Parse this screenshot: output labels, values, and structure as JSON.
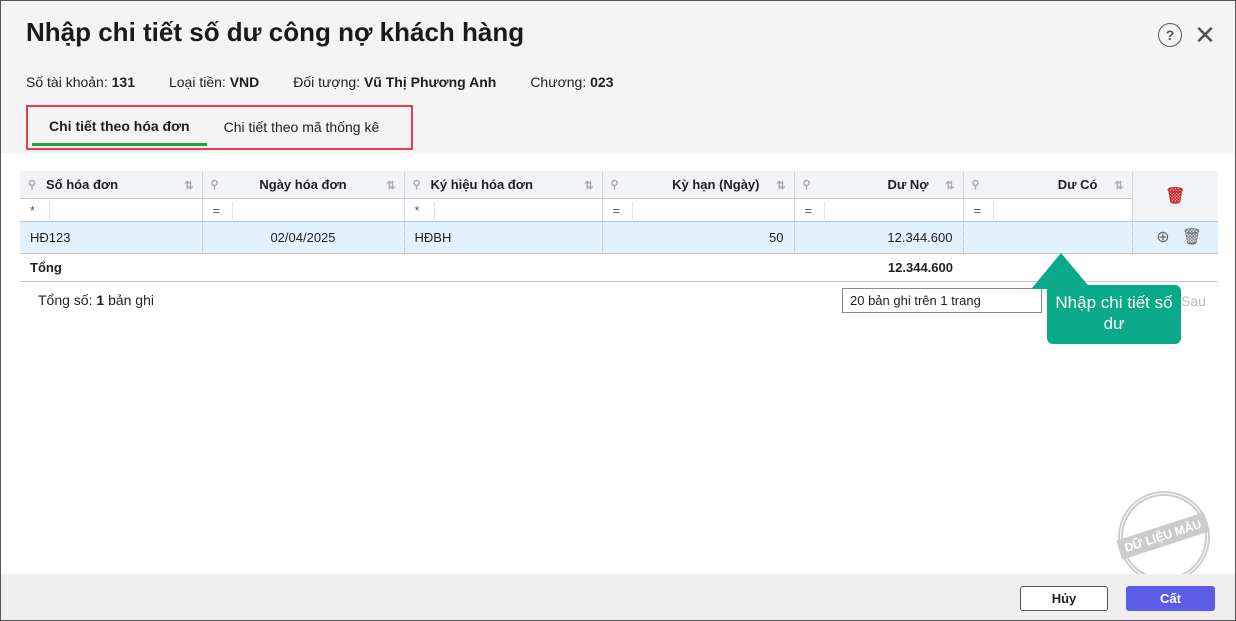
{
  "title": "Nhập chi tiết số dư công nợ khách hàng",
  "info": [
    {
      "label": "Số tài khoản:",
      "value": "131"
    },
    {
      "label": "Loại tiền:",
      "value": "VND"
    },
    {
      "label": "Đối tượng:",
      "value": "Vũ Thị Phương Anh"
    },
    {
      "label": "Chương:",
      "value": "023"
    }
  ],
  "tabs": [
    {
      "label": "Chi tiết theo hóa đơn"
    },
    {
      "label": "Chi tiết theo mã thống kê"
    }
  ],
  "columns": [
    {
      "label": "Số hóa đơn",
      "filter": "*"
    },
    {
      "label": "Ngày hóa đơn",
      "filter": "="
    },
    {
      "label": "Ký hiệu hóa đơn",
      "filter": "*"
    },
    {
      "label": "Kỳ hạn (Ngày)",
      "filter": "="
    },
    {
      "label": "Dư Nợ",
      "filter": "="
    },
    {
      "label": "Dư Có",
      "filter": "="
    }
  ],
  "rows": [
    {
      "so_hd": "HĐ123",
      "ngay": "02/04/2025",
      "ky_hieu": "HĐBH",
      "ky_han": "50",
      "du_no": "12.344.600",
      "du_co": ""
    }
  ],
  "total": {
    "label": "Tổng",
    "du_no": "12.344.600"
  },
  "count": {
    "prefix": "Tổng số:",
    "value": "1",
    "suffix": "bản ghi"
  },
  "pager": {
    "page_size": "20 bản ghi trên 1 trang",
    "next": "Sau"
  },
  "tooltip": "Nhập chi tiết số dư",
  "stamp": "DỮ LIỆU MẪU",
  "buttons": {
    "cancel": "Hủy",
    "save": "Cất"
  }
}
